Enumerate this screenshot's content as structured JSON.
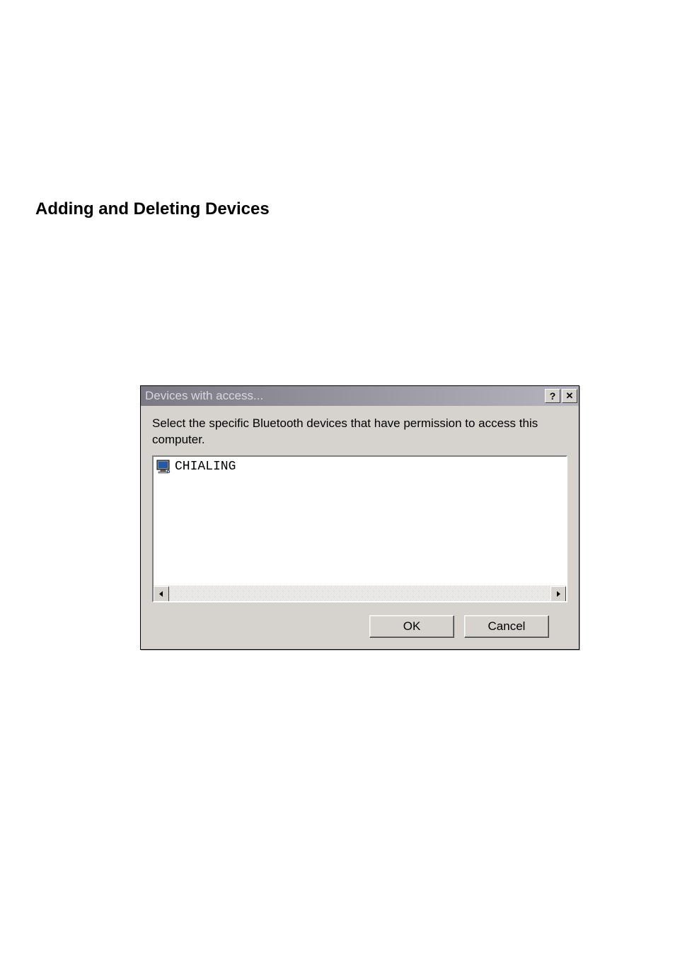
{
  "page": {
    "heading": "Adding and Deleting Devices"
  },
  "dialog": {
    "title": "Devices with access...",
    "help_glyph": "?",
    "close_glyph": "✕",
    "instruction": "Select the specific Bluetooth devices that have permission to access this computer.",
    "items": [
      {
        "label": "CHIALING"
      }
    ],
    "buttons": {
      "ok": "OK",
      "cancel": "Cancel"
    }
  }
}
